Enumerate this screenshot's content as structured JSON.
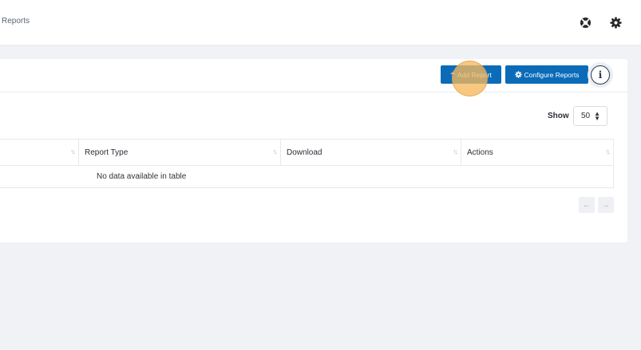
{
  "header": {
    "breadcrumb": "Reports",
    "icons": [
      "support-icon",
      "settings-gear-icon"
    ]
  },
  "toolbar": {
    "add_report_label": "Add Report",
    "configure_reports_label": "Configure Reports",
    "info_label": "i",
    "accent_color": "#0b6bb8"
  },
  "table_controls": {
    "show_label": "Show",
    "page_size": "50"
  },
  "table": {
    "columns": [
      {
        "label": ""
      },
      {
        "label": "Report Type"
      },
      {
        "label": "Download"
      },
      {
        "label": "Actions"
      }
    ],
    "empty_message": "No data available in table"
  },
  "pagination": {
    "prev_label": "←",
    "next_label": "→"
  }
}
